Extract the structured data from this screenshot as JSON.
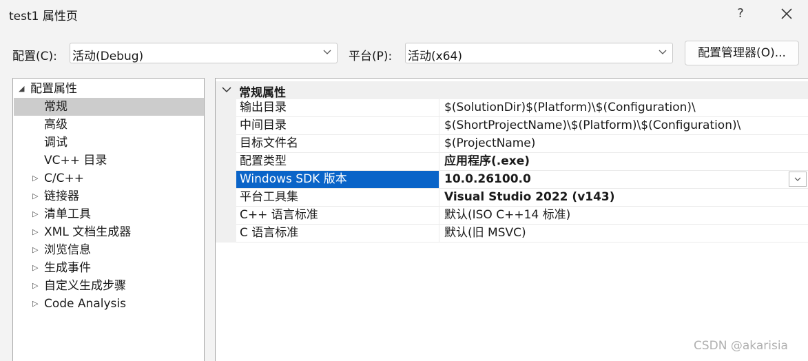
{
  "window": {
    "title": "test1 属性页",
    "help": "?"
  },
  "config": {
    "label": "配置(C):",
    "value": "活动(Debug)"
  },
  "platform": {
    "label": "平台(P):",
    "value": "活动(x64)"
  },
  "manager_button": "配置管理器(O)...",
  "tree": {
    "items": [
      {
        "label": "配置属性",
        "expanded": true
      },
      {
        "label": "常规",
        "selected": true
      },
      {
        "label": "高级"
      },
      {
        "label": "调试"
      },
      {
        "label": "VC++ 目录"
      },
      {
        "label": "C/C++",
        "collapsed": true
      },
      {
        "label": "链接器",
        "collapsed": true
      },
      {
        "label": "清单工具",
        "collapsed": true
      },
      {
        "label": "XML 文档生成器",
        "collapsed": true
      },
      {
        "label": "浏览信息",
        "collapsed": true
      },
      {
        "label": "生成事件",
        "collapsed": true
      },
      {
        "label": "自定义生成步骤",
        "collapsed": true
      },
      {
        "label": "Code Analysis",
        "collapsed": true
      }
    ]
  },
  "grid": {
    "category": "常规属性",
    "rows": [
      {
        "name": "输出目录",
        "value": "$(SolutionDir)$(Platform)\\$(Configuration)\\"
      },
      {
        "name": "中间目录",
        "value": "$(ShortProjectName)\\$(Platform)\\$(Configuration)\\"
      },
      {
        "name": "目标文件名",
        "value": "$(ProjectName)"
      },
      {
        "name": "配置类型",
        "value": "应用程序(.exe)",
        "bold": true
      },
      {
        "name": "Windows SDK 版本",
        "value": "10.0.26100.0",
        "bold": true,
        "selected": true
      },
      {
        "name": "平台工具集",
        "value": "Visual Studio 2022 (v143)",
        "bold": true
      },
      {
        "name": "C++ 语言标准",
        "value": "默认(ISO C++14 标准)"
      },
      {
        "name": "C 语言标准",
        "value": "默认(旧 MSVC)"
      }
    ]
  },
  "watermark": "CSDN @akarisia",
  "colors": {
    "selection": "#0a64c8",
    "tree_selection": "#cccccc"
  }
}
